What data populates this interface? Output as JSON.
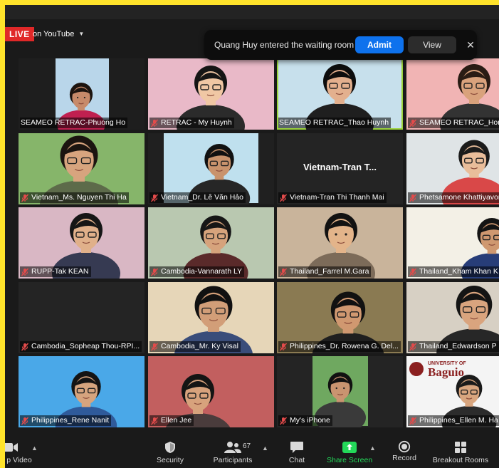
{
  "top": {
    "live_badge": "LIVE",
    "stream_label": "on YouTube"
  },
  "notification": {
    "message": "Quang Huy entered the waiting room",
    "admit_label": "Admit",
    "view_label": "View",
    "close_icon": "close-icon"
  },
  "participants": [
    {
      "name": "SEAMEO RETRAC-Phuong Ho",
      "muted": false
    },
    {
      "name": "RETRAC - My Huynh",
      "muted": true
    },
    {
      "name": "SEAMEO RETRAC_Thao Huynh",
      "muted": false
    },
    {
      "name": "SEAMEO RETRAC_Hong",
      "muted": true
    },
    {
      "name": "Vietnam_Ms. Nguyen Thi Ha",
      "muted": true
    },
    {
      "name": "Vietnam_Dr. Lê Văn Hảo",
      "muted": true
    },
    {
      "name": "Vietnam-Tran Thi Thanh Mai",
      "muted": true,
      "placeholder": "Vietnam-Tran  T..."
    },
    {
      "name": "Phetsamone Khattiyavong",
      "muted": true
    },
    {
      "name": "RUPP-Tak KEAN",
      "muted": true
    },
    {
      "name": "Cambodia-Vannarath LY",
      "muted": true
    },
    {
      "name": "Thailand_Farrel M.Gara",
      "muted": true
    },
    {
      "name": "Thailand_Kham Khan K",
      "muted": true
    },
    {
      "name": "Cambodia_Sopheap Thou-RPI...",
      "muted": true
    },
    {
      "name": "Cambodia_Mr. Ky Visal",
      "muted": true
    },
    {
      "name": "Philippines_Dr. Rowena G. Del...",
      "muted": true
    },
    {
      "name": "Thailand_Edwardson P",
      "muted": true
    },
    {
      "name": "Philippines_Rene Nanit",
      "muted": true
    },
    {
      "name": "Ellen Jee",
      "muted": true
    },
    {
      "name": "My's iPhone",
      "muted": true
    },
    {
      "name": "Philippines_Ellen M. Ha",
      "muted": true
    }
  ],
  "tile_texts": {
    "baguio_line1": "UNIVERSITY OF",
    "baguio_line2": "Baguio"
  },
  "toolbar": {
    "video_label": "p Video",
    "security_label": "Security",
    "participants_label": "Participants",
    "participants_count": "67",
    "chat_label": "Chat",
    "share_label": "Share Screen",
    "record_label": "Record",
    "breakout_label": "Breakout Rooms"
  },
  "colors": {
    "active_speaker": "#9cd43b",
    "share_green": "#23d959",
    "admit_blue": "#0e72ed",
    "live_red": "#e02828",
    "frame_yellow": "#ffe32b"
  }
}
